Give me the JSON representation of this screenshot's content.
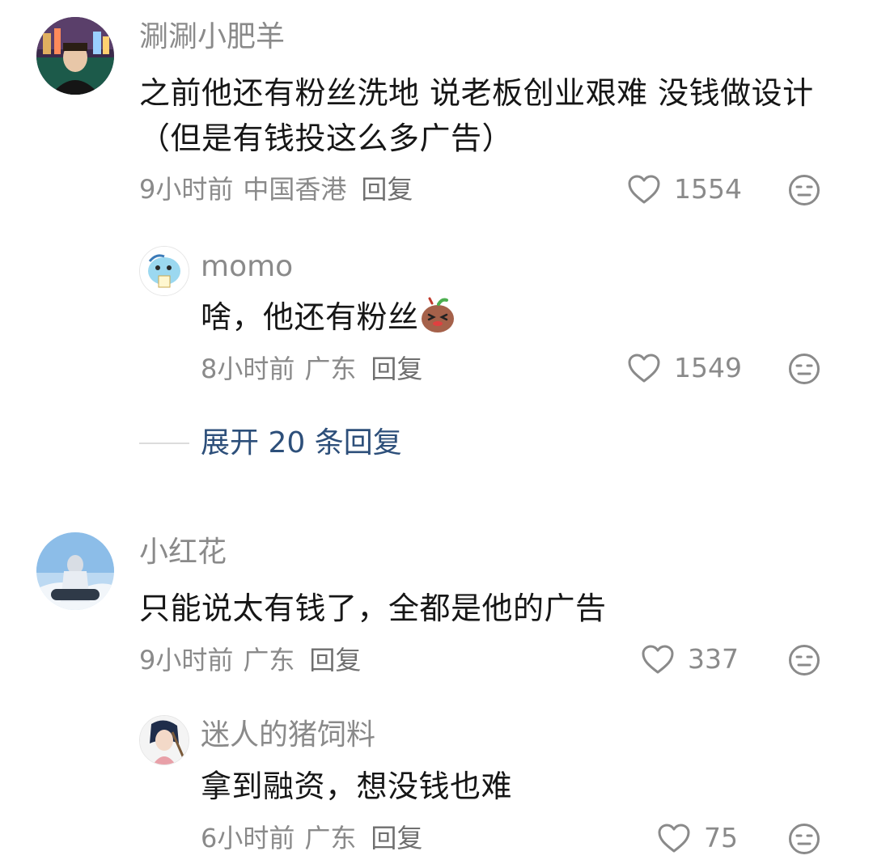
{
  "comments": [
    {
      "username": "涮涮小肥羊",
      "text": "之前他还有粉丝洗地 说老板创业艰难 没钱做设计（但是有钱投这么多广告）",
      "time": "9小时前",
      "location": "中国香港",
      "reply_label": "回复",
      "likes": "1554",
      "replies": [
        {
          "username": "momo",
          "text": "啥，他还有粉丝",
          "time": "8小时前",
          "location": "广东",
          "reply_label": "回复",
          "likes": "1549"
        }
      ],
      "expand_label": "展开 20 条回复"
    },
    {
      "username": "小红花",
      "text": "只能说太有钱了，全都是他的广告",
      "time": "9小时前",
      "location": "广东",
      "reply_label": "回复",
      "likes": "337",
      "replies": [
        {
          "username": "迷人的猪饲料",
          "text": "拿到融资，想没钱也难",
          "time": "6小时前",
          "location": "广东",
          "reply_label": "回复",
          "likes": "75"
        }
      ]
    }
  ],
  "icons": {
    "like": "heart-outline-icon",
    "dislike": "meh-face-icon"
  },
  "colors": {
    "username": "#8a8a8a",
    "text": "#161616",
    "expand_link": "#2d4f7a"
  }
}
